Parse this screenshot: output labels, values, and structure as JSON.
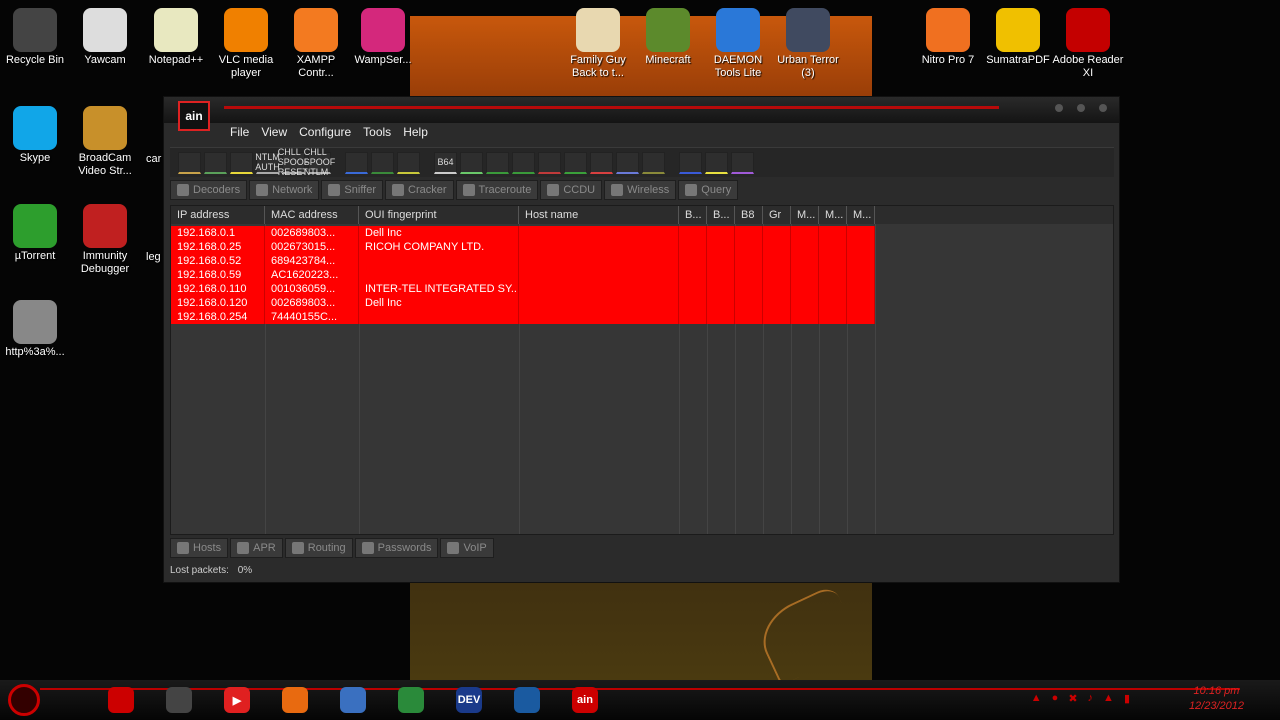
{
  "desktop": {
    "icons_left": [
      {
        "label": "Recycle Bin",
        "icon": "recycle-bin-icon",
        "color": "#444"
      },
      {
        "label": "Yawcam",
        "icon": "webcam-icon",
        "color": "#ddd"
      },
      {
        "label": "Notepad++",
        "icon": "notepad-icon",
        "color": "#e8e8c0"
      },
      {
        "label": "VLC media player",
        "icon": "vlc-cone-icon",
        "color": "#f08000"
      },
      {
        "label": "XAMPP Contr...",
        "icon": "xampp-icon",
        "color": "#f37a20"
      },
      {
        "label": "WampSer...",
        "icon": "wamp-icon",
        "color": "#d4287c"
      }
    ],
    "icons_col1": [
      {
        "label": "Skype",
        "icon": "skype-icon",
        "color": "#11a6e8"
      },
      {
        "label": "µTorrent",
        "icon": "utorrent-icon",
        "color": "#2d9e2d"
      },
      {
        "label": "http%3a%...",
        "icon": "file-shortcut-icon",
        "color": "#888"
      }
    ],
    "icons_col2": [
      {
        "label": "BroadCam Video Str...",
        "icon": "broadcam-icon",
        "color": "#c8902a"
      },
      {
        "label": "Immunity Debugger",
        "icon": "immunity-icon",
        "color": "#c02020"
      }
    ],
    "partial_labels": [
      "car",
      "leg"
    ],
    "icons_top_mid": [
      {
        "label": "Family Guy Back to t...",
        "icon": "family-guy-icon",
        "color": "#e8d8b0"
      },
      {
        "label": "Minecraft",
        "icon": "minecraft-icon",
        "color": "#5c8a2c"
      },
      {
        "label": "DAEMON Tools Lite",
        "icon": "daemon-tools-icon",
        "color": "#2a78d8"
      },
      {
        "label": "Urban Terror (3)",
        "icon": "urban-terror-icon",
        "color": "#404a60"
      }
    ],
    "icons_top_right": [
      {
        "label": "Nitro Pro 7",
        "icon": "nitro-icon",
        "color": "#f07020"
      },
      {
        "label": "SumatraPDF",
        "icon": "sumatra-icon",
        "color": "#f0c000"
      },
      {
        "label": "Adobe Reader XI",
        "icon": "adobe-reader-icon",
        "color": "#c40000"
      }
    ]
  },
  "app": {
    "logo_text": "ain",
    "menu": [
      "File",
      "View",
      "Configure",
      "Tools",
      "Help"
    ],
    "toolbar_labels": [
      "",
      "",
      "",
      "NTLM AUTH",
      "CHLL SPOOF RESET",
      "CHLL SPOOF NTLM",
      "",
      "",
      "",
      "B64",
      "",
      "",
      "",
      "",
      "",
      "",
      "",
      "",
      "",
      "",
      ""
    ],
    "tabs_top": [
      "Decoders",
      "Network",
      "Sniffer",
      "Cracker",
      "Traceroute",
      "CCDU",
      "Wireless",
      "Query"
    ],
    "columns": [
      "IP address",
      "MAC address",
      "OUI fingerprint",
      "Host name",
      "B...",
      "B...",
      "B8",
      "Gr",
      "M...",
      "M...",
      "M..."
    ],
    "rows": [
      [
        "192.168.0.1",
        "002689803...",
        "Dell Inc",
        "",
        "",
        "",
        "",
        "",
        "",
        "",
        ""
      ],
      [
        "192.168.0.25",
        "002673015...",
        "RICOH COMPANY LTD.",
        "",
        "",
        "",
        "",
        "",
        "",
        "",
        ""
      ],
      [
        "192.168.0.52",
        "689423784...",
        "",
        "",
        "",
        "",
        "",
        "",
        "",
        "",
        ""
      ],
      [
        "192.168.0.59",
        "AC1620223...",
        "",
        "",
        "",
        "",
        "",
        "",
        "",
        "",
        ""
      ],
      [
        "192.168.0.110",
        "001036059...",
        "INTER-TEL INTEGRATED SY...",
        "",
        "",
        "",
        "",
        "",
        "",
        "",
        ""
      ],
      [
        "192.168.0.120",
        "002689803...",
        "Dell Inc",
        "",
        "",
        "",
        "",
        "",
        "",
        "",
        ""
      ],
      [
        "192.168.0.254",
        "74440155C...",
        "",
        "",
        "",
        "",
        "",
        "",
        "",
        "",
        ""
      ]
    ],
    "tabs_bottom": [
      "Hosts",
      "APR",
      "Routing",
      "Passwords",
      "VoIP"
    ],
    "status": {
      "label": "Lost packets:",
      "value": "0%"
    },
    "row_color": "#ff0000"
  },
  "taskbar": {
    "items": [
      {
        "icon": "media-center-icon",
        "color": "#c00",
        "text": ""
      },
      {
        "icon": "film-icon",
        "color": "#444",
        "text": ""
      },
      {
        "icon": "media-player-icon",
        "color": "#e02020",
        "text": "▶"
      },
      {
        "icon": "firefox-icon",
        "color": "#e86a10",
        "text": ""
      },
      {
        "icon": "app-shortcut-icon",
        "color": "#3a70c0",
        "text": ""
      },
      {
        "icon": "chrome-icon",
        "color": "#2a8a3a",
        "text": ""
      },
      {
        "icon": "devcpp-icon",
        "color": "#1a3a8a",
        "text": "DEV"
      },
      {
        "icon": "wave-app-icon",
        "color": "#1a5aa0",
        "text": ""
      },
      {
        "icon": "cain-icon",
        "color": "#c00",
        "text": "ain"
      }
    ],
    "clock_time": "10:16 pm",
    "clock_date": "12/23/2012"
  }
}
